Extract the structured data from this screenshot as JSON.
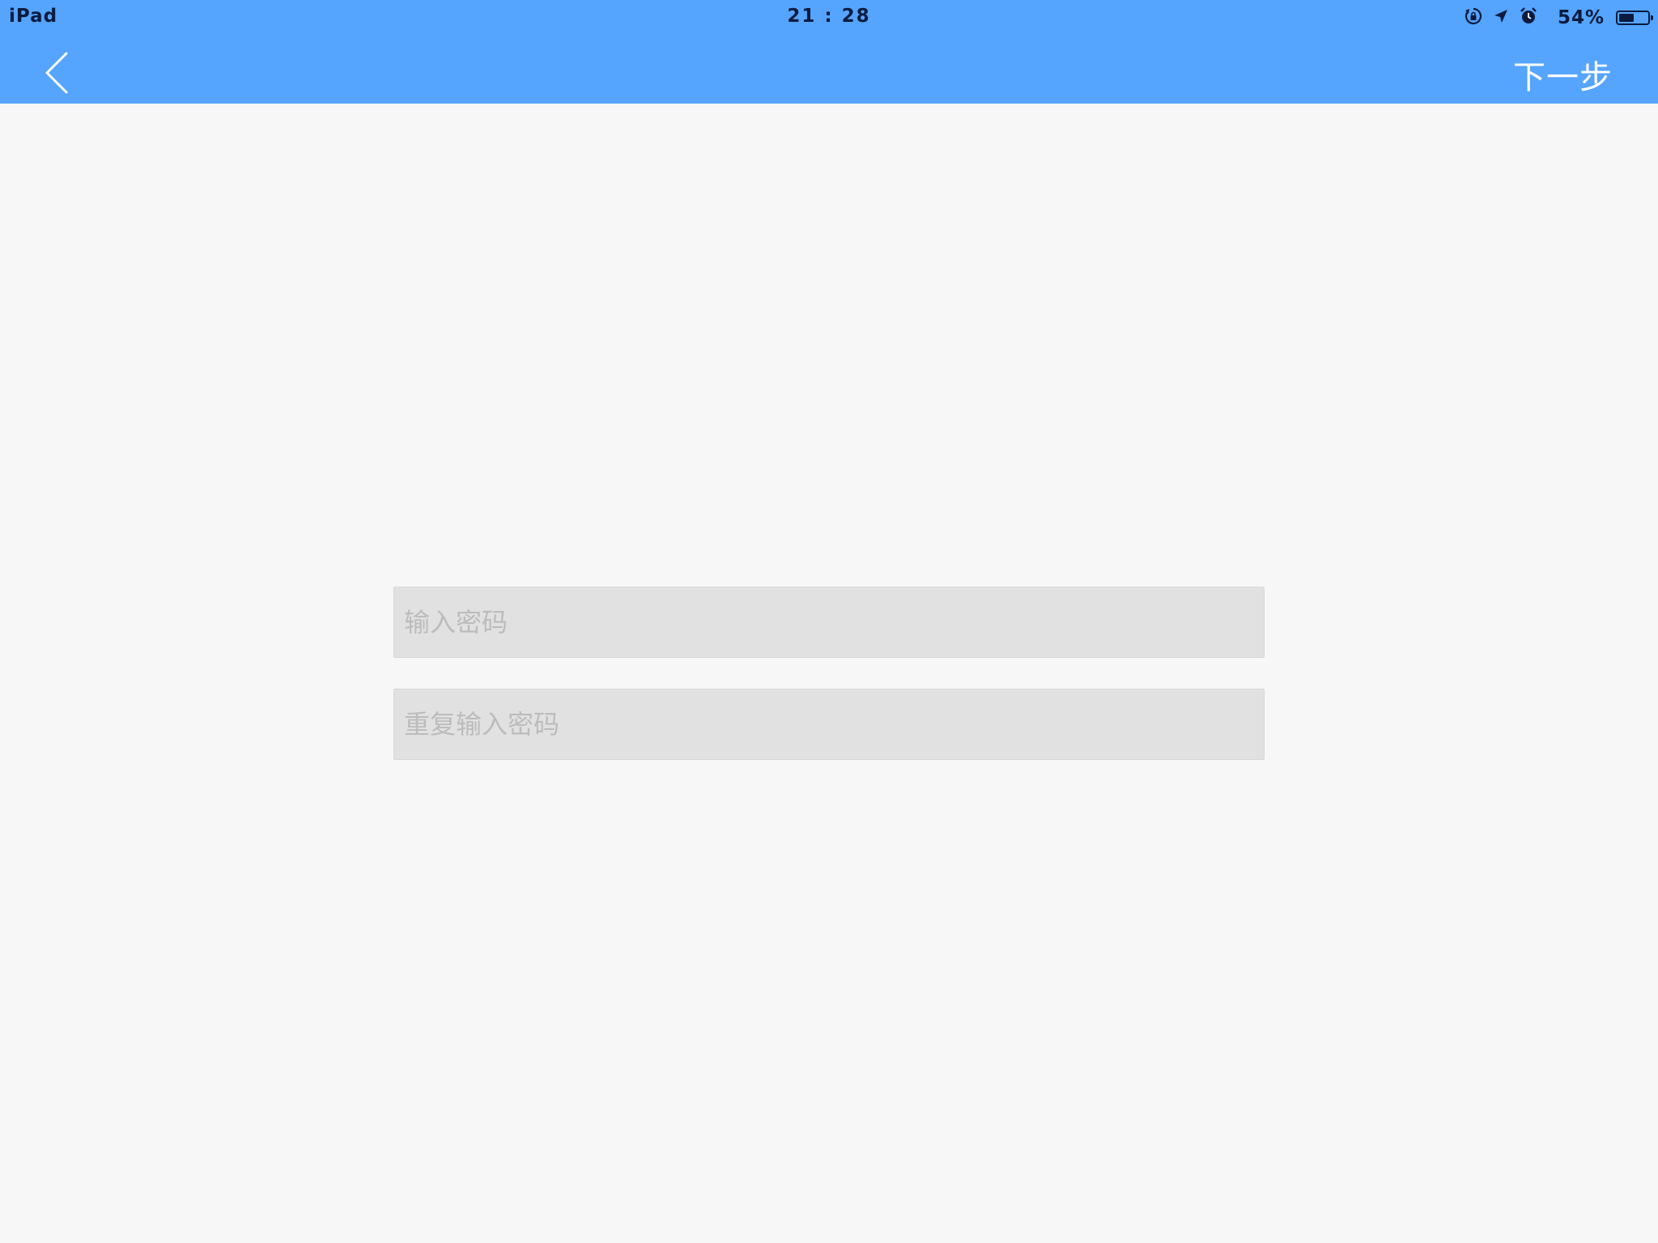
{
  "status_bar": {
    "device": "iPad",
    "time": "21 : 28",
    "battery_percent": "54%",
    "battery_level": 0.54,
    "icons": [
      "rotation-lock-icon",
      "location-arrow-icon",
      "alarm-icon",
      "battery-icon"
    ]
  },
  "nav": {
    "back_icon": "chevron-left-icon",
    "next_label": "下一步"
  },
  "form": {
    "password_placeholder": "输入密码",
    "confirm_placeholder": "重复输入密码",
    "password_value": "",
    "confirm_value": ""
  },
  "colors": {
    "header": "#55a4fe",
    "background": "#f7f7f7",
    "field": "#e1e1e1",
    "status_text": "#0b1b3f"
  }
}
